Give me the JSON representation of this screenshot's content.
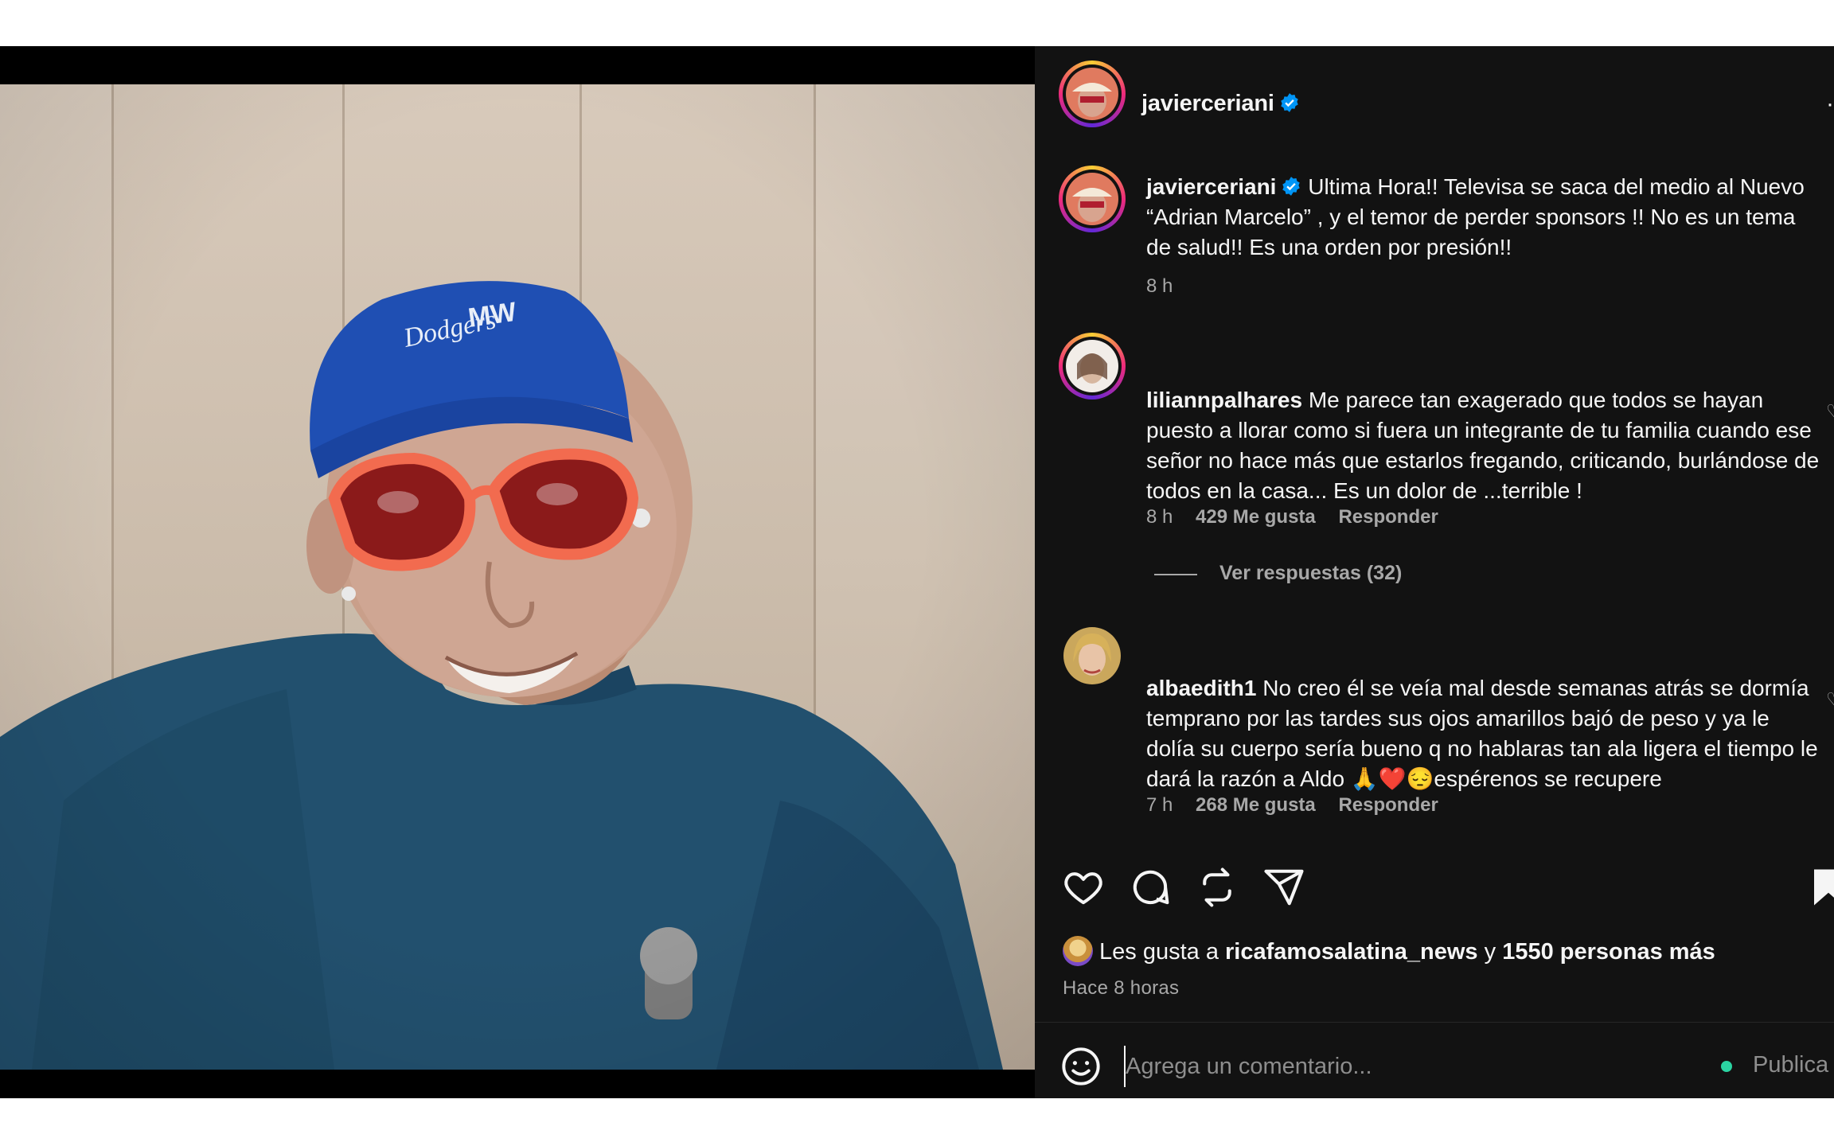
{
  "post": {
    "author": "javierceriani",
    "more_label": "·"
  },
  "caption": {
    "username": "javierceriani",
    "text": "Ultima Hora!! Televisa se saca del medio al Nuevo “Adrian Marcelo” , y el temor de perder sponsors !! No es un tema de salud!! Es una orden por presión!!",
    "time": "8 h"
  },
  "comments": [
    {
      "username": "liliannpalhares",
      "text": "Me parece tan exagerado que todos se hayan puesto a llorar como si fuera un integrante de tu familia cuando ese señor no hace más que estarlos fregando, criticando, burlándose de todos en la casa... Es un dolor de ...terrible !",
      "time": "8 h",
      "likes": "429 Me gusta",
      "reply": "Responder",
      "view_replies": "Ver respuestas (32)"
    },
    {
      "username": "albaedith1",
      "text": "No creo él se veía mal desde semanas atrás se dormía temprano por las tardes sus ojos amarillos bajó de peso y ya le dolía su cuerpo sería bueno q no hablaras tan ala ligera el tiempo le dará la razón a Aldo 🙏❤️😔espérenos se recupere",
      "time": "7 h",
      "likes": "268 Me gusta",
      "reply": "Responder"
    }
  ],
  "likes": {
    "prefix": "Les gusta a",
    "user": "ricafamosalatina_news",
    "joiner": "y",
    "others": "1550 personas más"
  },
  "post_time": "Hace 8 horas",
  "composer": {
    "placeholder": "Agrega un comentario...",
    "publish": "Publica"
  },
  "colors": {
    "panel_bg": "#121212",
    "verified": "#0095f6",
    "secondary_text": "#a8a8a8",
    "publish_dot": "#2bd4a2"
  },
  "icons": [
    "verified-badge-icon",
    "heart-icon",
    "comment-icon",
    "repost-icon",
    "share-icon",
    "bookmark-icon",
    "emoji-icon",
    "small-heart-icon"
  ]
}
